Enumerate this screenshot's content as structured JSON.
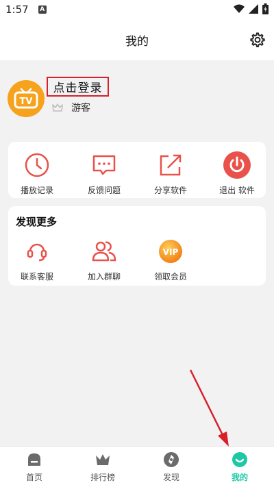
{
  "status": {
    "time": "1:57",
    "badge": "A"
  },
  "header": {
    "title": "我的"
  },
  "profile": {
    "login_label": "点击登录",
    "role": "游客"
  },
  "quick_actions": [
    {
      "label": "播放记录",
      "icon": "clock-icon"
    },
    {
      "label": "反馈问题",
      "icon": "feedback-icon"
    },
    {
      "label": "分享软件",
      "icon": "share-icon"
    },
    {
      "label": "退出 软件",
      "icon": "power-icon"
    }
  ],
  "discover": {
    "title": "发现更多",
    "items": [
      {
        "label": "联系客服",
        "icon": "headset-icon"
      },
      {
        "label": "加入群聊",
        "icon": "group-icon"
      },
      {
        "label": "领取会员",
        "icon": "vip-icon",
        "badge": "VIP"
      }
    ]
  },
  "tabs": [
    {
      "label": "首页",
      "icon": "home-icon"
    },
    {
      "label": "排行榜",
      "icon": "crown-icon"
    },
    {
      "label": "发现",
      "icon": "discover-icon"
    },
    {
      "label": "我的",
      "icon": "profile-icon",
      "active": true
    }
  ],
  "colors": {
    "accent_red": "#e8524a",
    "active_tab": "#1ec8a5",
    "avatar_orange": "#f6a21c",
    "highlight_border": "#d8202a"
  }
}
